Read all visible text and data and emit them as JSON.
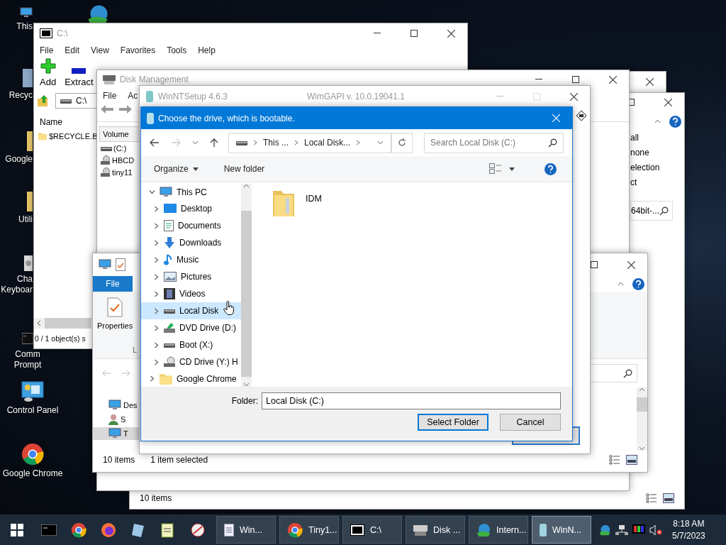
{
  "desktop_icons": [
    {
      "lines": [
        "This"
      ]
    },
    {
      "lines": [
        "Recyc"
      ]
    },
    {
      "lines": [
        "Google"
      ]
    },
    {
      "lines": [
        "Utili"
      ]
    },
    {
      "lines": [
        "Cha",
        "Keyboar"
      ]
    },
    {
      "lines": [
        "Comm",
        "Prompt"
      ]
    },
    {
      "lines": [
        "Control Panel"
      ]
    },
    {
      "lines": [
        "Google Chrome"
      ]
    }
  ],
  "explorer_back": {
    "ribbon_items": [
      "all",
      "none",
      "election",
      "ct"
    ],
    "search": "64bit-...",
    "status": "10 items"
  },
  "sevenzip": {
    "title": "C:\\",
    "menu": [
      "File",
      "Edit",
      "View",
      "Favorites",
      "Tools",
      "Help"
    ],
    "toolbar": [
      "Add",
      "Extract"
    ],
    "address": "C:\\",
    "column": "Name",
    "rows": [
      "$RECYCLE.B"
    ],
    "status": "0 / 1 object(s) s"
  },
  "disk_management": {
    "title": "Disk Management",
    "menu": [
      "File",
      "Ac"
    ],
    "column": "Volume",
    "rows": [
      "(C:)",
      "HBCD",
      "tiny11"
    ]
  },
  "this_pc": {
    "ribbon_tab": "File",
    "ribbon_button": "Properties",
    "group_label": "L",
    "nav": [
      {
        "label": "Des",
        "selected": false
      },
      {
        "label": "S",
        "selected": false
      },
      {
        "label": "T",
        "selected": true
      }
    ],
    "status": [
      "10 items",
      "1 item selected"
    ]
  },
  "winntsetup": {
    "title": "WinNTSetup 4.6.3",
    "version": "WimGAPI v. 10.0.19041.1"
  },
  "dialog": {
    "title": "Choose the drive, which is bootable.",
    "breadcrumb": [
      "This ...",
      "Local Disk..."
    ],
    "search": {
      "placeholder": "Search Local Disk (C:)"
    },
    "toolbar": [
      "Organize",
      "New folder"
    ],
    "tree": [
      {
        "label": "This PC",
        "expanded": true,
        "selected": false,
        "children": [
          {
            "label": "Desktop",
            "expanded": false,
            "selected": false
          },
          {
            "label": "Documents",
            "expanded": false,
            "selected": false
          },
          {
            "label": "Downloads",
            "expanded": false,
            "selected": false
          },
          {
            "label": "Music",
            "expanded": false,
            "selected": false
          },
          {
            "label": "Pictures",
            "expanded": false,
            "selected": false
          },
          {
            "label": "Videos",
            "expanded": false,
            "selected": false
          },
          {
            "label": "Local Disk",
            "expanded": false,
            "selected": true
          },
          {
            "label": "DVD Drive (D:)",
            "expanded": false,
            "selected": false
          },
          {
            "label": "Boot (X:)",
            "expanded": false,
            "selected": false
          },
          {
            "label": "CD Drive (Y:) H",
            "expanded": false,
            "selected": false
          }
        ]
      },
      {
        "label": "Google Chrome",
        "expanded": false,
        "selected": false
      }
    ],
    "items": [
      "IDM"
    ],
    "folder_label": "Folder:",
    "folder_value": "Local Disk (C:)",
    "buttons": [
      {
        "label": "Select Folder",
        "default": true
      },
      {
        "label": "Cancel",
        "default": false
      }
    ]
  },
  "taskbar": {
    "buttons": [
      {
        "label": "Win...",
        "active": false
      },
      {
        "label": "Tiny1...",
        "active": false
      },
      {
        "label": "C:\\",
        "active": false
      },
      {
        "label": "Disk ...",
        "active": false
      },
      {
        "label": "Intern...",
        "active": false
      },
      {
        "label": "WinN...",
        "active": true
      }
    ],
    "time": "8:18 AM",
    "date": "5/7/2023"
  }
}
